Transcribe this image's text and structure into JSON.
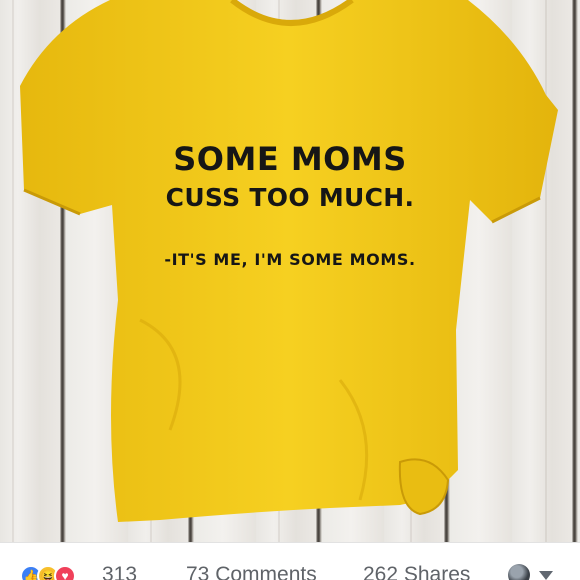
{
  "shirt": {
    "color": "#f4cd1d",
    "slogan_line1": "SOME MOMS",
    "slogan_line2": "CUSS TOO MUCH.",
    "slogan_line3": "-IT'S ME, I'M SOME MOMS."
  },
  "social_bar": {
    "reaction_icons": [
      "like-icon",
      "haha-icon",
      "love-icon"
    ],
    "reaction_count": "313",
    "comments": "73 Comments",
    "shares": "262 Shares"
  }
}
